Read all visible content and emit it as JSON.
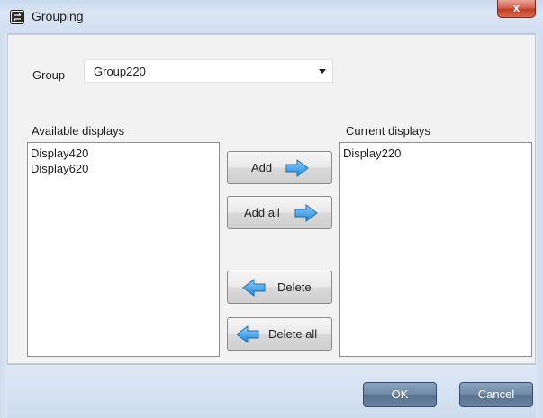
{
  "window": {
    "title": "Grouping",
    "close_label": "x"
  },
  "group": {
    "label": "Group",
    "selected": "Group220"
  },
  "available": {
    "label": "Available displays",
    "items": [
      "Display420",
      "Display620"
    ]
  },
  "current": {
    "label": "Current displays",
    "items": [
      "Display220"
    ]
  },
  "actions": {
    "add": "Add",
    "add_all": "Add all",
    "delete": "Delete",
    "delete_all": "Delete all"
  },
  "footer": {
    "ok": "OK",
    "cancel": "Cancel"
  },
  "colors": {
    "arrow_blue": "#2f9be6",
    "footer_button": "#6f89a6",
    "close_button": "#c33d26"
  }
}
